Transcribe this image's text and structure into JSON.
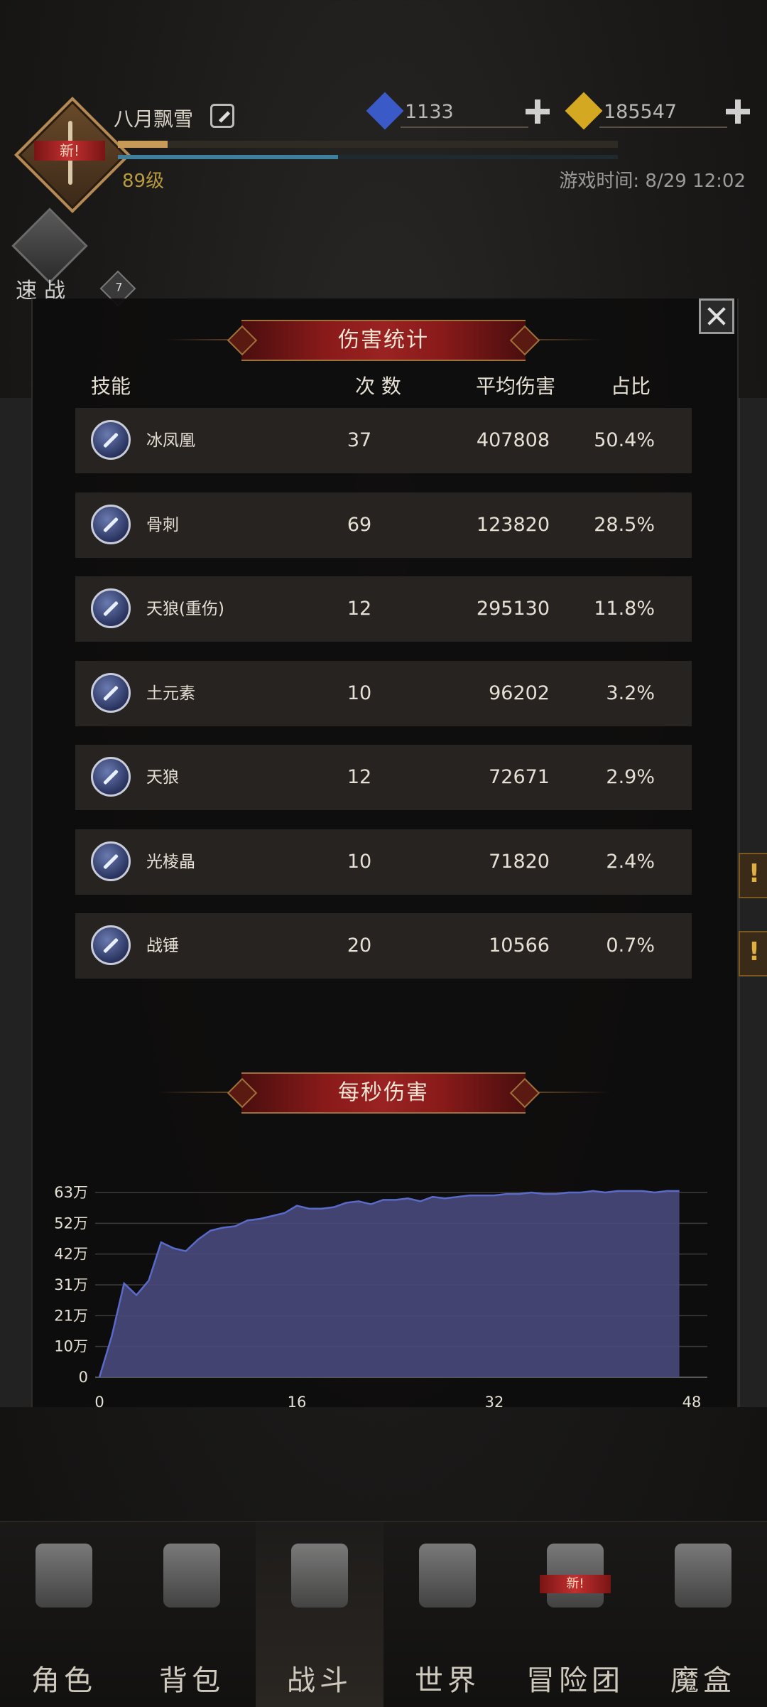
{
  "header": {
    "player_name": "八月飘雪",
    "avatar_new_badge": "新!",
    "avatar_level_badge": "7",
    "level": "89级",
    "game_time": "游戏时间: 8/29 12:02",
    "exp_fraction": 0.1,
    "hp_fraction": 0.44,
    "currencies": [
      {
        "name": "blue-gem",
        "amount": "1133",
        "color": "#3a5ac8"
      },
      {
        "name": "gold-gem",
        "amount": "185547",
        "color": "#d4a820"
      }
    ],
    "quick_battle_label": "速战"
  },
  "modal": {
    "damage_title": "伤害统计",
    "columns": {
      "skill": "技能",
      "count": "次 数",
      "avg": "平均伤害",
      "pct": "占比"
    },
    "skills": [
      {
        "name": "冰凤凰",
        "count": "37",
        "avg": "407808",
        "pct": "50.4%",
        "icon": "ice-phoenix-icon"
      },
      {
        "name": "骨刺",
        "count": "69",
        "avg": "123820",
        "pct": "28.5%",
        "icon": "bone-spike-icon"
      },
      {
        "name": "天狼(重伤)",
        "count": "12",
        "avg": "295130",
        "pct": "11.8%",
        "icon": "sky-wolf-wound-icon"
      },
      {
        "name": "土元素",
        "count": "10",
        "avg": "96202",
        "pct": "3.2%",
        "icon": "earth-elemental-icon"
      },
      {
        "name": "天狼",
        "count": "12",
        "avg": "72671",
        "pct": "2.9%",
        "icon": "sky-wolf-icon"
      },
      {
        "name": "光棱晶",
        "count": "10",
        "avg": "71820",
        "pct": "2.4%",
        "icon": "prism-crystal-icon"
      },
      {
        "name": "战锤",
        "count": "20",
        "avg": "10566",
        "pct": "0.7%",
        "icon": "warhammer-icon"
      }
    ],
    "dps_title": "每秒伤害"
  },
  "chart_data": {
    "type": "area",
    "title": "每秒伤害",
    "x": [
      0,
      1,
      2,
      3,
      4,
      5,
      6,
      7,
      8,
      9,
      10,
      11,
      12,
      13,
      14,
      15,
      16,
      17,
      18,
      19,
      20,
      21,
      22,
      23,
      24,
      25,
      26,
      27,
      28,
      29,
      30,
      31,
      32,
      33,
      34,
      35,
      36,
      37,
      38,
      39,
      40,
      41,
      42,
      43,
      44,
      45,
      46,
      47
    ],
    "series": [
      {
        "values": [
          0,
          14,
          32,
          28,
          33,
          46,
          44,
          43,
          47,
          50,
          51,
          51.5,
          53.5,
          54,
          55,
          56,
          58.5,
          57.5,
          57.5,
          58,
          59.5,
          60,
          59,
          60.5,
          60.5,
          61,
          60,
          61.5,
          61,
          61.5,
          62,
          62,
          62,
          62.5,
          62.5,
          63,
          62.5,
          62.5,
          63,
          63,
          63.5,
          63,
          63.5,
          63.5,
          63.5,
          63,
          63.5,
          63.5
        ],
        "color": "#5a6ac8"
      }
    ],
    "xticks": [
      "0",
      "16",
      "32",
      "48"
    ],
    "yticks": [
      "0",
      "10万",
      "21万",
      "31万",
      "42万",
      "52万",
      "63万"
    ],
    "xlim": [
      0,
      48
    ],
    "ylim": [
      0,
      63
    ],
    "grid": true,
    "fill_color": "#48487a"
  },
  "nav": {
    "items": [
      {
        "label": "角色",
        "icon": "helmet-icon"
      },
      {
        "label": "背包",
        "icon": "backpack-icon"
      },
      {
        "label": "战斗",
        "icon": "shield-sword-icon"
      },
      {
        "label": "世界",
        "icon": "map-scroll-icon"
      },
      {
        "label": "冒险团",
        "icon": "castle-icon",
        "new_badge": "新!"
      },
      {
        "label": "魔盒",
        "icon": "magic-box-icon"
      }
    ],
    "active_index": 2
  }
}
